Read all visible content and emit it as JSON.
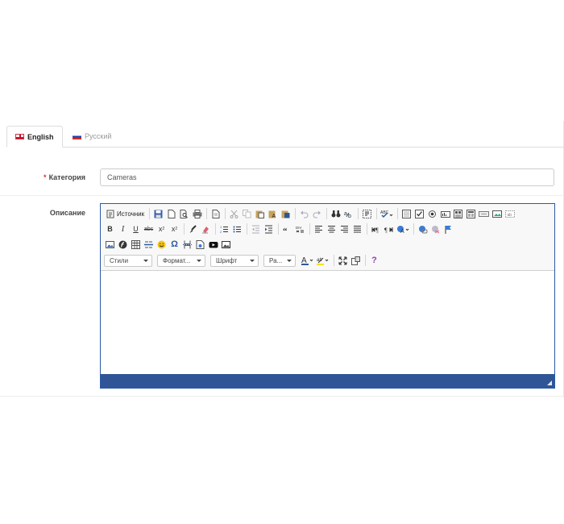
{
  "tabs": [
    {
      "label": "English",
      "flag": "uk-flag-icon",
      "active": true
    },
    {
      "label": "Русский",
      "flag": "ru-flag-icon",
      "active": false
    }
  ],
  "category": {
    "label": "Категория",
    "required_mark": "*",
    "value": "Cameras"
  },
  "description": {
    "label": "Описание"
  },
  "editor": {
    "source_label": "Источник",
    "combos": {
      "styles": "Стили",
      "format": "Формат...",
      "font": "Шрифт",
      "size": "Ра..."
    },
    "bold": "B",
    "italic": "I",
    "underline": "U",
    "strike": "abc",
    "subscript": "x",
    "superscript": "x",
    "help": "?",
    "omega": "Ω",
    "status_color": "#2f5597"
  }
}
